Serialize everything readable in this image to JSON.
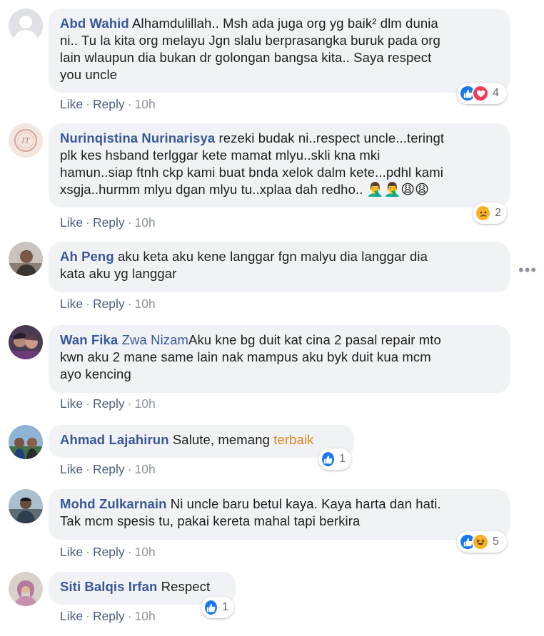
{
  "comments": [
    {
      "author": "Abd Wahid",
      "text_lines": [
        "Alhamdulillah.. Msh ada juga org yg baik² dlm dunia",
        "ni.. Tu la kita org melayu Jgn slalu berprasangka buruk pada org",
        "lain wlaupun dia bukan dr golongan bangsa kita.. Saya respect",
        "you uncle"
      ],
      "like": "Like",
      "reply": "Reply",
      "time": "10h",
      "reactions": {
        "icons": [
          "like-icon",
          "love-icon"
        ],
        "count": "4"
      }
    },
    {
      "author": "Nurinqistina Nurinarisya",
      "text_lines": [
        "rezeki budak ni..respect uncle...teringt",
        "plk kes hsband terlggar kete mamat mlyu..skli kna mki",
        "hamun..siap ftnh ckp kami buat bnda xelok dalm kete...pdhl kami",
        "xsgja..hurmm mlyu dgan mlyu tu..xplaa dah redho.."
      ],
      "emojis": "🤦‍♂️🤦‍♂️😩😩",
      "like": "Like",
      "reply": "Reply",
      "time": "10h",
      "reactions": {
        "icons": [
          "sad-icon"
        ],
        "count": "2"
      }
    },
    {
      "author": "Ah Peng",
      "text_lines": [
        "aku keta aku kene langgar fgn malyu dia langgar dia",
        "kata aku yg langgar"
      ],
      "like": "Like",
      "reply": "Reply",
      "time": "10h",
      "more": "•••"
    },
    {
      "author": "Wan Fika",
      "author_second": "Zwa Nizam",
      "text_lines": [
        "Aku kne bg duit kat cina 2 pasal repair mto",
        "kwn aku 2 mane same lain nak mampus aku byk duit kua mcm",
        "ayo kencing"
      ],
      "like": "Like",
      "reply": "Reply",
      "time": "10h"
    },
    {
      "author": "Ahmad Lajahirun",
      "text": "Salute, memang",
      "highlight": "terbaik",
      "like": "Like",
      "reply": "Reply",
      "time": "10h",
      "reactions": {
        "icons": [
          "like-icon"
        ],
        "count": "1"
      }
    },
    {
      "author": "Mohd Zulkarnain",
      "text_lines": [
        "Ni uncle baru betul kaya. Kaya harta dan hati.",
        "Tak mcm spesis tu, pakai kereta mahal tapi berkira"
      ],
      "like": "Like",
      "reply": "Reply",
      "time": "10h",
      "reactions": {
        "icons": [
          "like-icon",
          "haha-icon"
        ],
        "count": "5"
      }
    },
    {
      "author": "Siti Balqis Irfan",
      "text": "Respect",
      "like": "Like",
      "reply": "Reply",
      "time": "10h",
      "reactions": {
        "icons": [
          "like-icon"
        ],
        "count": "1"
      }
    }
  ],
  "colors": {
    "author": "#385898",
    "bubble": "#f0f2f5",
    "action": "#4b5f7d",
    "like": "#1877f2",
    "love": "#f33e58",
    "highlight": "#e4821c"
  }
}
